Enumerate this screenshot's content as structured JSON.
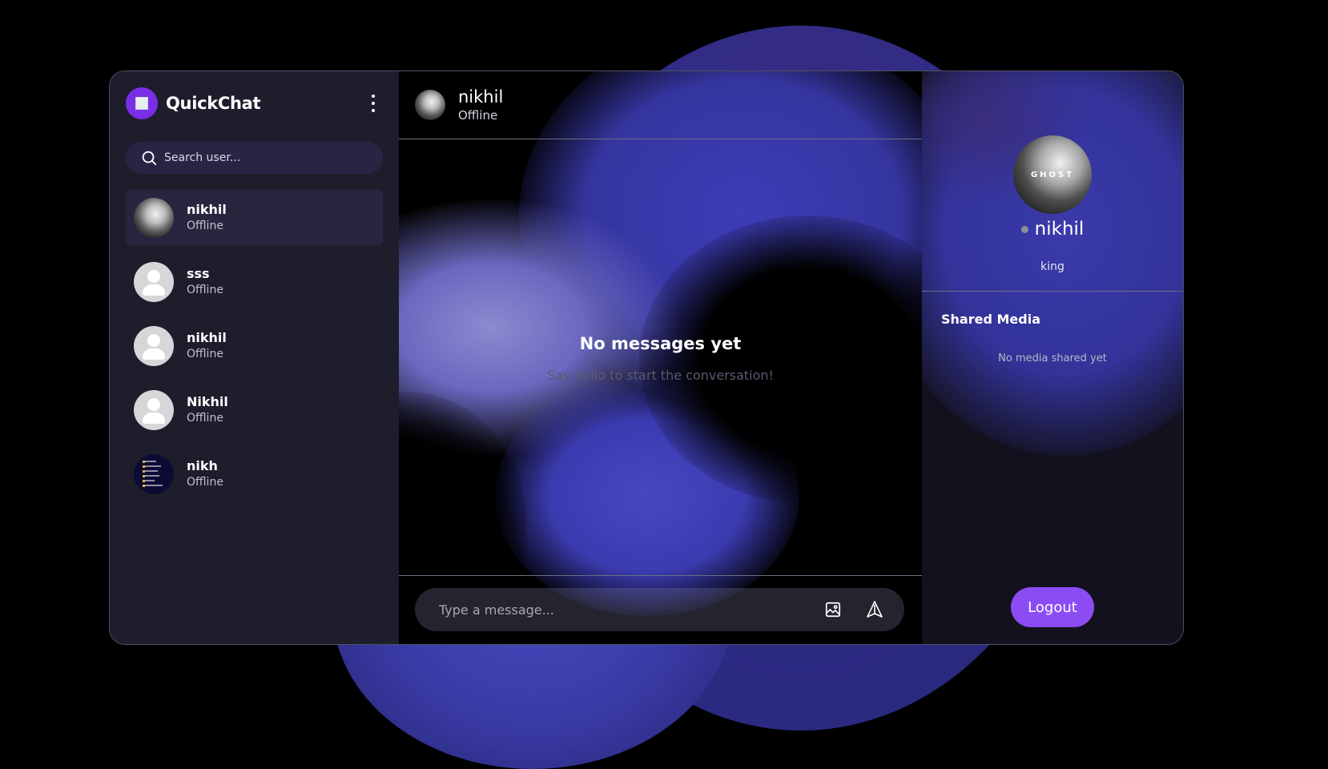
{
  "app": {
    "name": "QuickChat"
  },
  "sidebar": {
    "search_placeholder": "Search user...",
    "users": [
      {
        "name": "nikhil",
        "status": "Offline",
        "avatar": "ghost-image",
        "active": true
      },
      {
        "name": "sss",
        "status": "Offline",
        "avatar": "default-user-icon"
      },
      {
        "name": "nikhil",
        "status": "Offline",
        "avatar": "default-user-icon"
      },
      {
        "name": "Nikhil",
        "status": "Offline",
        "avatar": "default-user-icon"
      },
      {
        "name": "nikh",
        "status": "Offline",
        "avatar": "file-list-image"
      }
    ]
  },
  "chat": {
    "header": {
      "name": "nikhil",
      "status": "Offline"
    },
    "empty_title": "No messages yet",
    "empty_subtitle": "Say hello to start the conversation!",
    "composer_placeholder": "Type a message..."
  },
  "profile": {
    "name": "nikhil",
    "bio": "king",
    "avatar_text": "GHOST",
    "shared_media_title": "Shared Media",
    "shared_media_empty": "No media shared yet",
    "logout_label": "Logout"
  },
  "colors": {
    "accent": "#8b4cf3",
    "brand_logo_bg": "#7a2ee8",
    "sidebar_bg": "#1e1d2c",
    "offline_dot": "#8e8e98"
  }
}
